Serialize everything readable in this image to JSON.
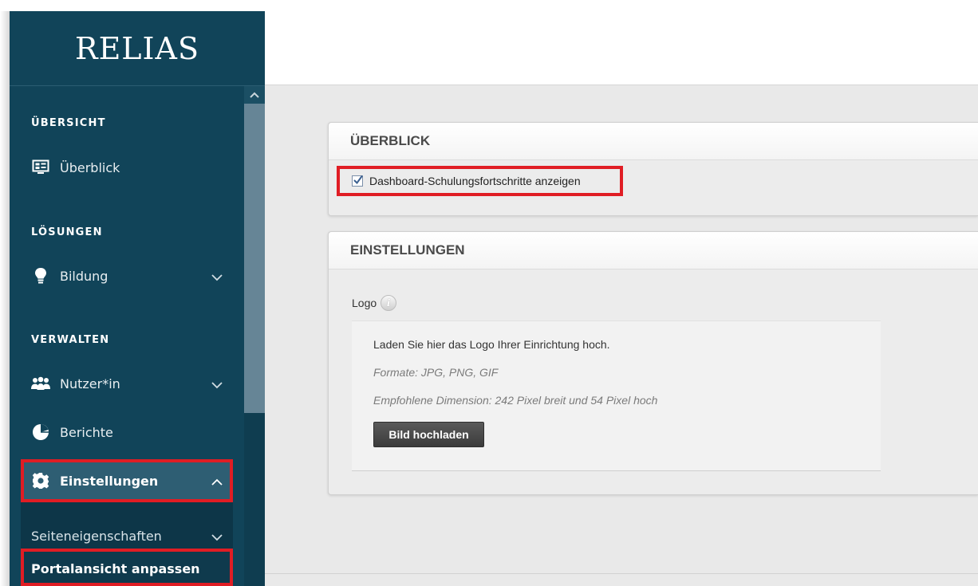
{
  "brand": {
    "logo_text": "RELIAS"
  },
  "sidebar": {
    "sections": [
      {
        "label": "ÜBERSICHT"
      },
      {
        "label": "LÖSUNGEN"
      },
      {
        "label": "VERWALTEN"
      }
    ],
    "items": [
      {
        "label": "Überblick",
        "icon": "dashboard-icon"
      },
      {
        "label": "Bildung",
        "icon": "lightbulb-icon",
        "expandable": true
      },
      {
        "label": "Nutzer*in",
        "icon": "users-icon",
        "expandable": true
      },
      {
        "label": "Berichte",
        "icon": "pie-chart-icon"
      },
      {
        "label": "Einstellungen",
        "icon": "gear-icon",
        "expanded": true
      }
    ],
    "subitems": [
      {
        "label": "Seiteneigenschaften",
        "expandable": true
      },
      {
        "label": "Portalansicht anpassen",
        "current": true
      }
    ]
  },
  "main": {
    "panels": [
      {
        "title": "ÜBERBLICK",
        "checkbox": {
          "label": "Dashboard-Schulungsfortschritte anzeigen",
          "checked": true
        }
      },
      {
        "title": "EINSTELLUNGEN",
        "field_label": "Logo",
        "info_icon": "i",
        "upload": {
          "instruction": "Laden Sie hier das Logo Ihrer Einrichtung hoch.",
          "formats": "Formate: JPG, PNG, GIF",
          "dimension": "Empfohlene Dimension: 242 Pixel breit und 54 Pixel hoch",
          "button_label": "Bild hochladen"
        }
      }
    ]
  },
  "colors": {
    "sidebar_bg": "#114459",
    "active_item_bg": "#2e5e73",
    "highlight": "#e01d24",
    "main_bg": "#e9e9e9"
  }
}
